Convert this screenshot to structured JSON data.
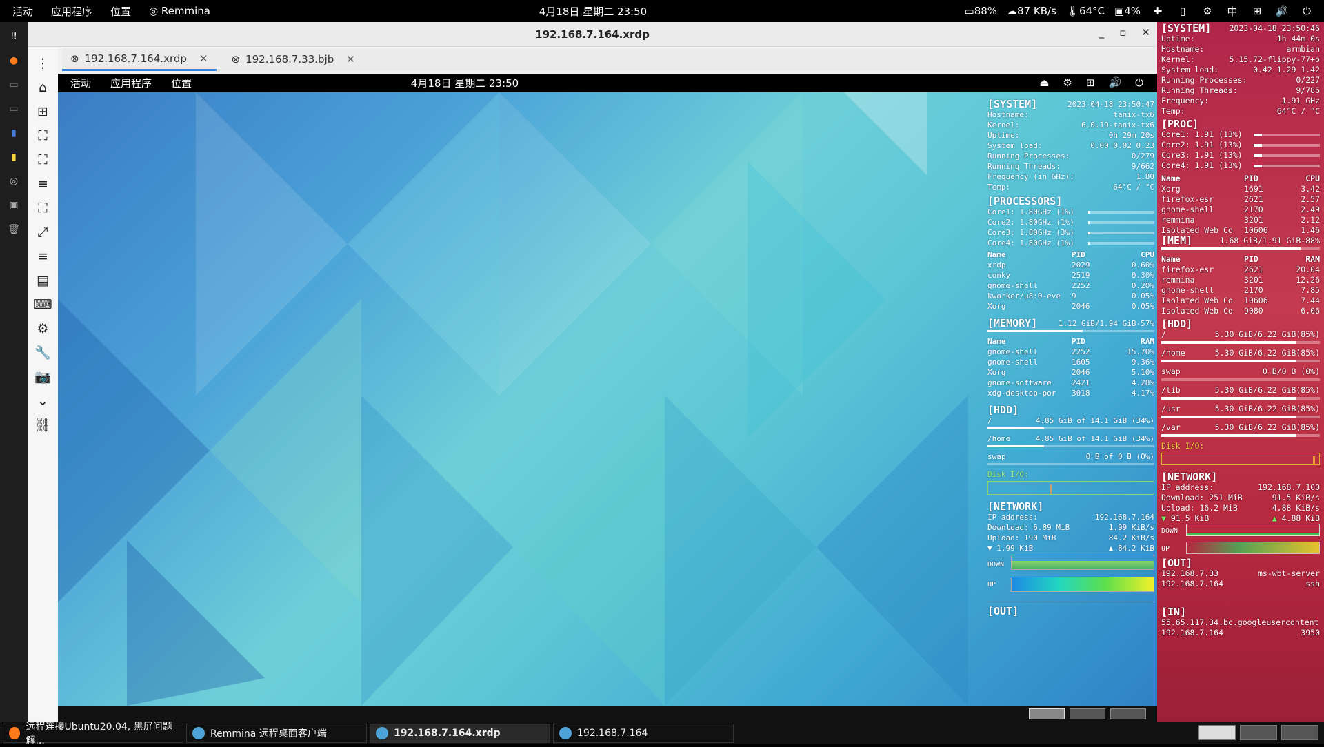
{
  "topbar": {
    "activities": "活动",
    "applications": "应用程序",
    "places": "位置",
    "app_name": "Remmina",
    "clock": "4月18日 星期二  23:50",
    "battery": "88%",
    "net_speed": "87 KB/s",
    "temp": "64°C",
    "disk": "4%",
    "ime": "中",
    "icons": [
      "extension-icon",
      "clipboard-icon",
      "settings-icon",
      "network-icon",
      "volume-icon",
      "power-icon"
    ]
  },
  "window": {
    "title": "192.168.7.164.xrdp",
    "tabs": [
      {
        "label": "192.168.7.164.xrdp",
        "active": true
      },
      {
        "label": "192.168.7.33.bjb",
        "active": false
      }
    ]
  },
  "remote_topbar": {
    "activities": "活动",
    "applications": "应用程序",
    "places": "位置",
    "clock": "4月18日 星期二  23:50"
  },
  "remote_conky": {
    "system_hdr": "[SYSTEM]",
    "datetime": "2023-04-18 23:50:47",
    "hostname_k": "Hostname:",
    "hostname_v": "tanix-tx6",
    "kernel_k": "Kernel:",
    "kernel_v": "6.0.19-tanix-tx6",
    "uptime_k": "Uptime:",
    "uptime_v": "0h 29m 20s",
    "load_k": "System load:",
    "load_v": "0.00 0.02 0.23",
    "procs_k": "Running Processes:",
    "procs_v": "0/279",
    "threads_k": "Running Threads:",
    "threads_v": "9/662",
    "freq_k": "Frequency (in GHz):",
    "freq_v": "1.80",
    "temp_k": "Temp:",
    "temp_v": "64°C / °C",
    "proc_hdr": "[PROCESSORS]",
    "cores": [
      {
        "label": "Core1: 1.80GHz (1%)",
        "pct": 1
      },
      {
        "label": "Core2: 1.80GHz (1%)",
        "pct": 1
      },
      {
        "label": "Core3: 1.80GHz (3%)",
        "pct": 3
      },
      {
        "label": "Core4: 1.80GHz (1%)",
        "pct": 1
      }
    ],
    "cpu_cols": [
      "Name",
      "PID",
      "CPU"
    ],
    "cpu_rows": [
      [
        "xrdp",
        "2029",
        "0.60%"
      ],
      [
        "conky",
        "2519",
        "0.30%"
      ],
      [
        "gnome-shell",
        "2252",
        "0.20%"
      ],
      [
        "kworker/u8:0-eve",
        "9",
        "0.05%"
      ],
      [
        "Xorg",
        "2046",
        "0.05%"
      ]
    ],
    "mem_hdr": "[MEMORY]",
    "mem_v": "1.12 GiB/1.94 GiB-57%",
    "mem_pct": 57,
    "mem_cols": [
      "Name",
      "PID",
      "RAM"
    ],
    "mem_rows": [
      [
        "gnome-shell",
        "2252",
        "15.70%"
      ],
      [
        "gnome-shell",
        "1605",
        "9.36%"
      ],
      [
        "Xorg",
        "2046",
        "5.10%"
      ],
      [
        "gnome-software",
        "2421",
        "4.28%"
      ],
      [
        "xdg-desktop-por",
        "3018",
        "4.17%"
      ]
    ],
    "hdd_hdr": "[HDD]",
    "hdd": [
      {
        "k": "/",
        "v": "4.85 GiB of 14.1 GiB (34%)",
        "pct": 34
      },
      {
        "k": "/home",
        "v": "4.85 GiB of 14.1 GiB (34%)",
        "pct": 34
      },
      {
        "k": "swap",
        "v": "0 B of 0 B (0%)",
        "pct": 0
      }
    ],
    "diskio": "Disk I/O:",
    "net_hdr": "[NETWORK]",
    "ip_k": "IP address:",
    "ip_v": "192.168.7.164",
    "dl_k": "Download:",
    "dl_total": "6.89 MiB",
    "dl_rate": "1.99 KiB/s",
    "ul_k": "Upload:",
    "ul_total": "190 MiB",
    "ul_rate": "84.2 KiB/s",
    "down_now": "1.99 KiB",
    "up_now": "84.2 KiB",
    "down_lbl": "DOWN",
    "up_lbl": "UP",
    "out_hdr": "[OUT]"
  },
  "host_conky": {
    "system_hdr": "[SYSTEM]",
    "datetime": "2023-04-18 23:50:46",
    "uptime_k": "Uptime:",
    "uptime_v": "1h 44m 0s",
    "hostname_k": "Hostname:",
    "hostname_v": "armbian",
    "kernel_k": "Kernel:",
    "kernel_v": "5.15.72-flippy-77+o",
    "load_k": "System load:",
    "load_v": "0.42 1.29 1.42",
    "procs_k": "Running Processes:",
    "procs_v": "0/227",
    "threads_k": "Running Threads:",
    "threads_v": "9/786",
    "freq_k": "Frequency:",
    "freq_v": "1.91 GHz",
    "temp_k": "Temp:",
    "temp_v": "64°C / °C",
    "proc_hdr": "[PROC]",
    "cores": [
      {
        "label": "Core1: 1.91 (13%)",
        "pct": 13
      },
      {
        "label": "Core2: 1.91 (13%)",
        "pct": 13
      },
      {
        "label": "Core3: 1.91 (13%)",
        "pct": 13
      },
      {
        "label": "Core4: 1.91 (13%)",
        "pct": 13
      }
    ],
    "cpu_cols": [
      "Name",
      "PID",
      "CPU"
    ],
    "cpu_rows": [
      [
        "Xorg",
        "1691",
        "3.42"
      ],
      [
        "firefox-esr",
        "2621",
        "2.57"
      ],
      [
        "gnome-shell",
        "2170",
        "2.49"
      ],
      [
        "remmina",
        "3201",
        "2.12"
      ],
      [
        "Isolated Web Co",
        "10606",
        "1.46"
      ]
    ],
    "mem_hdr": "[MEM]",
    "mem_v": "1.68 GiB/1.91 GiB-88%",
    "mem_pct": 88,
    "mem_cols": [
      "Name",
      "PID",
      "RAM"
    ],
    "mem_rows": [
      [
        "firefox-esr",
        "2621",
        "20.04"
      ],
      [
        "remmina",
        "3201",
        "12.26"
      ],
      [
        "gnome-shell",
        "2170",
        "7.85"
      ],
      [
        "Isolated Web Co",
        "10606",
        "7.44"
      ],
      [
        "Isolated Web Co",
        "9080",
        "6.06"
      ]
    ],
    "hdd_hdr": "[HDD]",
    "hdd": [
      {
        "k": "/",
        "v": "5.30 GiB/6.22 GiB(85%)",
        "pct": 85
      },
      {
        "k": "/home",
        "v": "5.30 GiB/6.22 GiB(85%)",
        "pct": 85
      },
      {
        "k": "swap",
        "v": "0 B/0 B (0%)",
        "pct": 0
      },
      {
        "k": "/lib",
        "v": "5.30 GiB/6.22 GiB(85%)",
        "pct": 85
      },
      {
        "k": "/usr",
        "v": "5.30 GiB/6.22 GiB(85%)",
        "pct": 85
      },
      {
        "k": "/var",
        "v": "5.30 GiB/6.22 GiB(85%)",
        "pct": 85
      }
    ],
    "diskio": "Disk I/O:",
    "net_hdr": "[NETWORK]",
    "ip_k": "IP address:",
    "ip_v": "192.168.7.100",
    "dl_k": "Download:",
    "dl_total": "251 MiB",
    "dl_rate": "91.5 KiB/s",
    "ul_k": "Upload:",
    "ul_total": "16.2 MiB",
    "ul_rate": "4.88 KiB/s",
    "down_now": "91.5 KiB",
    "up_now": "4.88 KiB",
    "down_lbl": "DOWN",
    "up_lbl": "UP",
    "out_hdr": "[OUT]",
    "out_rows": [
      [
        "192.168.7.33",
        "ms-wbt-server"
      ],
      [
        "192.168.7.164",
        "ssh"
      ]
    ],
    "in_hdr": "[IN]",
    "in_rows": [
      [
        "55.65.117.34.bc.googleusercontent",
        ""
      ],
      [
        "192.168.7.164",
        "3950"
      ]
    ]
  },
  "taskbar": {
    "tasks": [
      {
        "label": "远程连接Ubuntu20.04, 黑屏问题解...",
        "active": false
      },
      {
        "label": "Remmina 远程桌面客户端",
        "active": false
      },
      {
        "label": "192.168.7.164.xrdp",
        "active": true
      },
      {
        "label": "192.168.7.164",
        "active": false
      }
    ]
  },
  "colors": {
    "accent": "#3584e4",
    "conky_host_bg": "#b82a40",
    "desktop_teal": "#5cc6d6"
  }
}
